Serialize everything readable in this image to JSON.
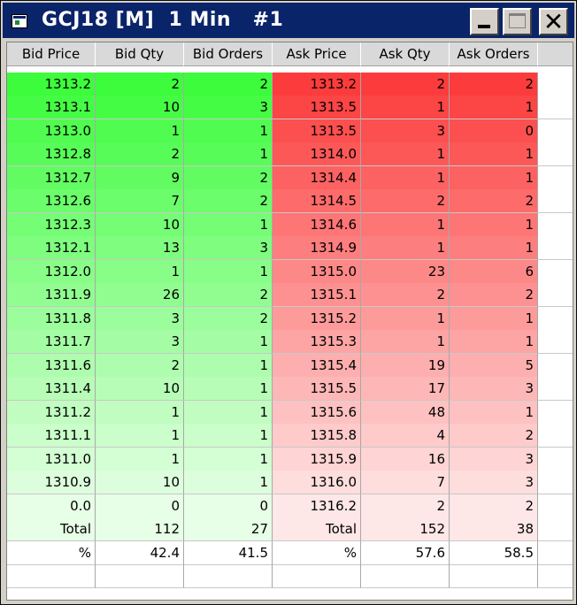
{
  "window": {
    "title": "GCJ18 [M]  1 Min   #1"
  },
  "headers": [
    "Bid Price",
    "Bid Qty",
    "Bid Orders",
    "Ask Price",
    "Ask Qty",
    "Ask Orders"
  ],
  "rows": [
    [
      "1313.2",
      "2",
      "2",
      "1313.2",
      "2",
      "2"
    ],
    [
      "1313.1",
      "10",
      "3",
      "1313.5",
      "1",
      "1"
    ],
    [
      "1313.0",
      "1",
      "1",
      "1313.5",
      "3",
      "0"
    ],
    [
      "1312.8",
      "2",
      "1",
      "1314.0",
      "1",
      "1"
    ],
    [
      "1312.7",
      "9",
      "2",
      "1314.4",
      "1",
      "1"
    ],
    [
      "1312.6",
      "7",
      "2",
      "1314.5",
      "2",
      "2"
    ],
    [
      "1312.3",
      "10",
      "1",
      "1314.6",
      "1",
      "1"
    ],
    [
      "1312.1",
      "13",
      "3",
      "1314.9",
      "1",
      "1"
    ],
    [
      "1312.0",
      "1",
      "1",
      "1315.0",
      "23",
      "6"
    ],
    [
      "1311.9",
      "26",
      "2",
      "1315.1",
      "2",
      "2"
    ],
    [
      "1311.8",
      "3",
      "2",
      "1315.2",
      "1",
      "1"
    ],
    [
      "1311.7",
      "3",
      "1",
      "1315.3",
      "1",
      "1"
    ],
    [
      "1311.6",
      "2",
      "1",
      "1315.4",
      "19",
      "5"
    ],
    [
      "1311.4",
      "10",
      "1",
      "1315.5",
      "17",
      "3"
    ],
    [
      "1311.2",
      "1",
      "1",
      "1315.6",
      "48",
      "1"
    ],
    [
      "1311.1",
      "1",
      "1",
      "1315.8",
      "4",
      "2"
    ],
    [
      "1311.0",
      "1",
      "1",
      "1315.9",
      "16",
      "3"
    ],
    [
      "1310.9",
      "10",
      "1",
      "1316.0",
      "7",
      "3"
    ],
    [
      "0.0",
      "0",
      "0",
      "1316.2",
      "2",
      "2"
    ]
  ],
  "totals": [
    "Total",
    "112",
    "27",
    "Total",
    "152",
    "38"
  ],
  "percent": [
    "%",
    "42.4",
    "41.5",
    "%",
    "57.6",
    "58.5"
  ],
  "colors": {
    "bid_top": "#3cfc3c",
    "bid_bottom": "#f0fef0",
    "ask_top": "#fc3c3c",
    "ask_bottom": "#fef0f0",
    "title_bar": "#0a246a"
  }
}
